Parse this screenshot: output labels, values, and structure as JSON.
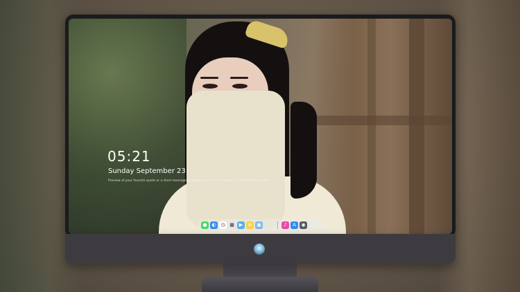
{
  "lock_screen": {
    "time": "05:21",
    "date": "Sunday September  23",
    "quote": "Preview of your favorite quote or a short message to display on the lock screen — customize it anytime"
  },
  "dock": {
    "left_group": [
      {
        "name": "messages-icon",
        "glyph": "●",
        "color": "#4cd964"
      },
      {
        "name": "finder-icon",
        "glyph": "◐",
        "color": "#3a8ee6"
      },
      {
        "name": "clock-icon",
        "glyph": "◷",
        "color": "#ffffff"
      },
      {
        "name": "calendar-icon",
        "glyph": "▦",
        "color": "#e8e8e8"
      },
      {
        "name": "movie-icon",
        "glyph": "▶",
        "color": "#5ab0e6"
      },
      {
        "name": "notes-icon",
        "glyph": "≡",
        "color": "#f7d34a"
      },
      {
        "name": "photos-icon",
        "glyph": "▣",
        "color": "#7fb8e8"
      }
    ],
    "right_group": [
      {
        "name": "music-icon",
        "glyph": "♪",
        "color": "#e84ba8"
      },
      {
        "name": "app-store-icon",
        "glyph": "A",
        "color": "#2d8cf0"
      },
      {
        "name": "camera-icon",
        "glyph": "◉",
        "color": "#555a60"
      }
    ]
  },
  "monitor": {
    "logo_icon": "monitor-brand-logo-icon"
  },
  "colors": {
    "bezel": "#1b1b1d",
    "chin": "#3e3b40",
    "dock_bg": "rgba(235,235,240,.45)"
  }
}
